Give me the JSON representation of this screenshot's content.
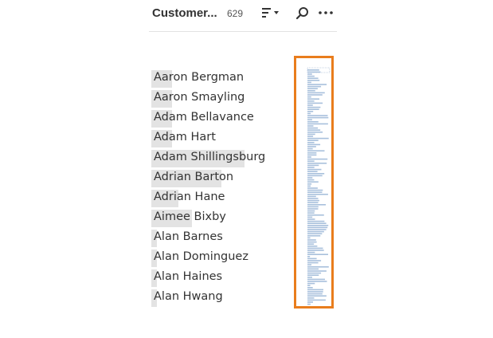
{
  "header": {
    "title": "Customer...",
    "count": "629",
    "icons": [
      "sort-icon",
      "search-icon",
      "more-icon"
    ]
  },
  "names": [
    {
      "label": "Aaron Bergman",
      "bar": 0.2
    },
    {
      "label": "Aaron Smayling",
      "bar": 0.2
    },
    {
      "label": "Adam Bellavance",
      "bar": 0.2
    },
    {
      "label": "Adam Hart",
      "bar": 0.2
    },
    {
      "label": "Adam Shillingsburg",
      "bar": 0.9
    },
    {
      "label": "Adrian Barton",
      "bar": 0.68
    },
    {
      "label": "Adrian Hane",
      "bar": 0.26
    },
    {
      "label": "Aimee Bixby",
      "bar": 0.39
    },
    {
      "label": "Alan Barnes",
      "bar": 0.05
    },
    {
      "label": "Alan Dominguez",
      "bar": 0.05
    },
    {
      "label": "Alan Haines",
      "bar": 0.05
    },
    {
      "label": "Alan Hwang",
      "bar": 0.05
    }
  ],
  "colors": {
    "accent": "#e97d1d",
    "bar": "#e3e3e3",
    "overview_bar": "#a8c0dc"
  }
}
